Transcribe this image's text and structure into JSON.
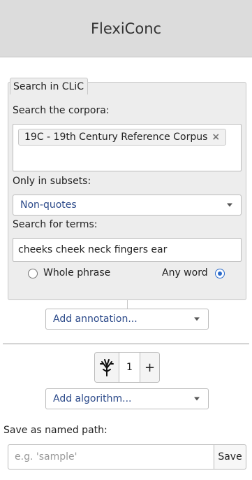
{
  "app": {
    "title": "FlexiConc"
  },
  "search_panel": {
    "legend": "Search in CLiC",
    "corpora_label": "Search the corpora:",
    "selected_corpus": "19C - 19th Century Reference Corpus",
    "remove_icon": "×",
    "subsets_label": "Only in subsets:",
    "subset_value": "Non-quotes",
    "terms_label": "Search for terms:",
    "terms_value": "cheeks cheek neck fingers ear",
    "match_modes": [
      {
        "label": "Whole phrase",
        "selected": false
      },
      {
        "label": "Any word",
        "selected": true
      }
    ]
  },
  "annotation_select": {
    "label": "Add annotation..."
  },
  "stepper": {
    "icon": "tree-icon",
    "value": "1",
    "plus_label": "+"
  },
  "algorithm_select": {
    "label": "Add algorithm..."
  },
  "save_path": {
    "label": "Save as named path:",
    "placeholder": "e.g. 'sample'",
    "button_label": "Save"
  },
  "colors": {
    "accent": "#2a6acb",
    "select_text": "#2c4a8a",
    "header_bg": "#dcdcdc",
    "panel_bg": "#ededed"
  }
}
